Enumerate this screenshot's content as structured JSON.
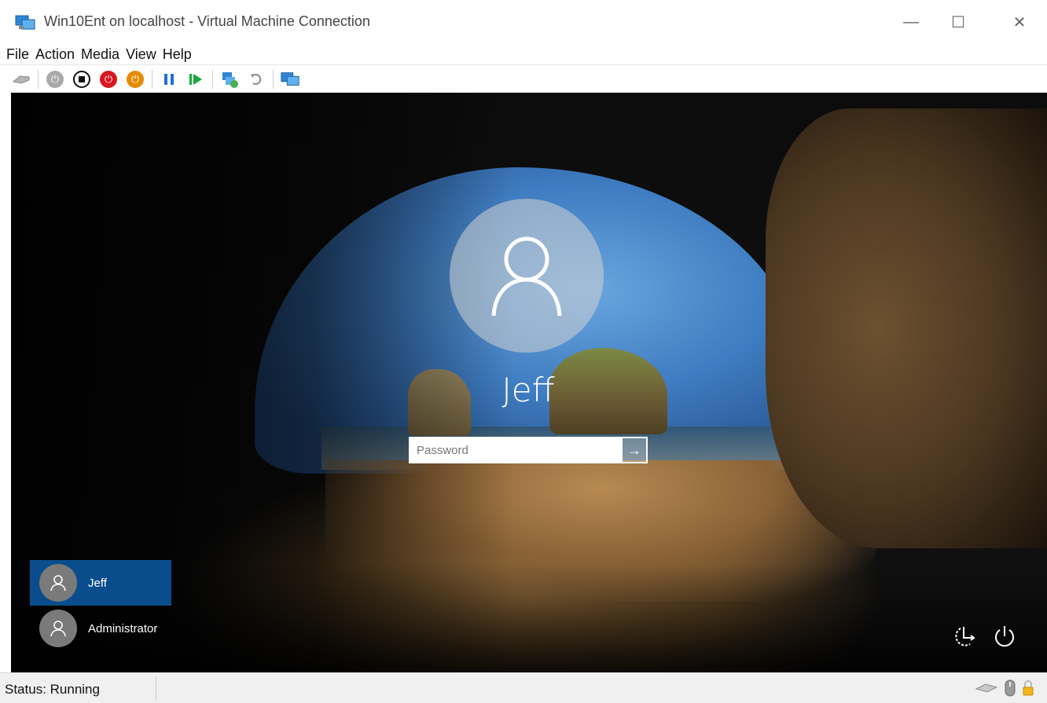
{
  "window": {
    "title": "Win10Ent on localhost - Virtual Machine Connection",
    "minimize_glyph": "—",
    "maximize_glyph": "☐",
    "close_glyph": "✕"
  },
  "menu": {
    "items": [
      {
        "label": "File"
      },
      {
        "label": "Action"
      },
      {
        "label": "Media"
      },
      {
        "label": "View"
      },
      {
        "label": "Help"
      }
    ]
  },
  "toolbar": {
    "buttons": [
      {
        "name": "ctrl-alt-del-icon"
      },
      {
        "name": "start-icon"
      },
      {
        "name": "turn-off-icon"
      },
      {
        "name": "shut-down-icon"
      },
      {
        "name": "save-icon"
      },
      {
        "name": "pause-icon"
      },
      {
        "name": "resume-icon"
      },
      {
        "name": "checkpoint-icon"
      },
      {
        "name": "revert-icon"
      },
      {
        "name": "enhanced-session-icon"
      }
    ],
    "colors": {
      "stop_red": "#d9161f",
      "save_orange": "#e68a00",
      "pause_blue": "#1e6fd9",
      "resume_green": "#19a83b",
      "gray": "#8c8c8c"
    }
  },
  "login": {
    "user_name": "Jeff",
    "password_placeholder": "Password",
    "submit_glyph": "→"
  },
  "users": [
    {
      "name": "Jeff",
      "selected": true
    },
    {
      "name": "Administrator",
      "selected": false
    }
  ],
  "status": {
    "text": "Status: Running"
  }
}
